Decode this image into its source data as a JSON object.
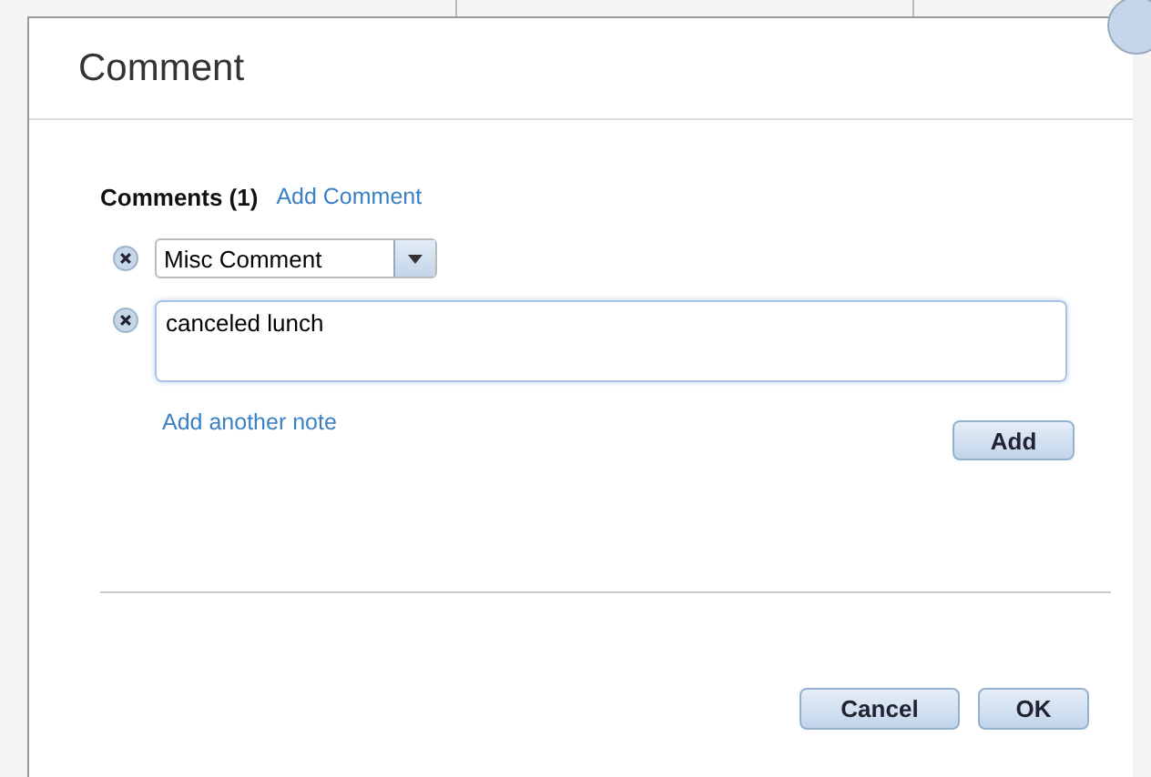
{
  "dialog": {
    "title": "Comment"
  },
  "comments": {
    "heading": "Comments (1)",
    "add_link": "Add Comment",
    "entries": [
      {
        "kind": "dropdown",
        "value": "Misc Comment"
      },
      {
        "kind": "textarea",
        "value": "canceled lunch"
      }
    ],
    "add_note_link": "Add another note",
    "add_button": "Add"
  },
  "buttons": [
    "Cancel",
    "OK"
  ]
}
